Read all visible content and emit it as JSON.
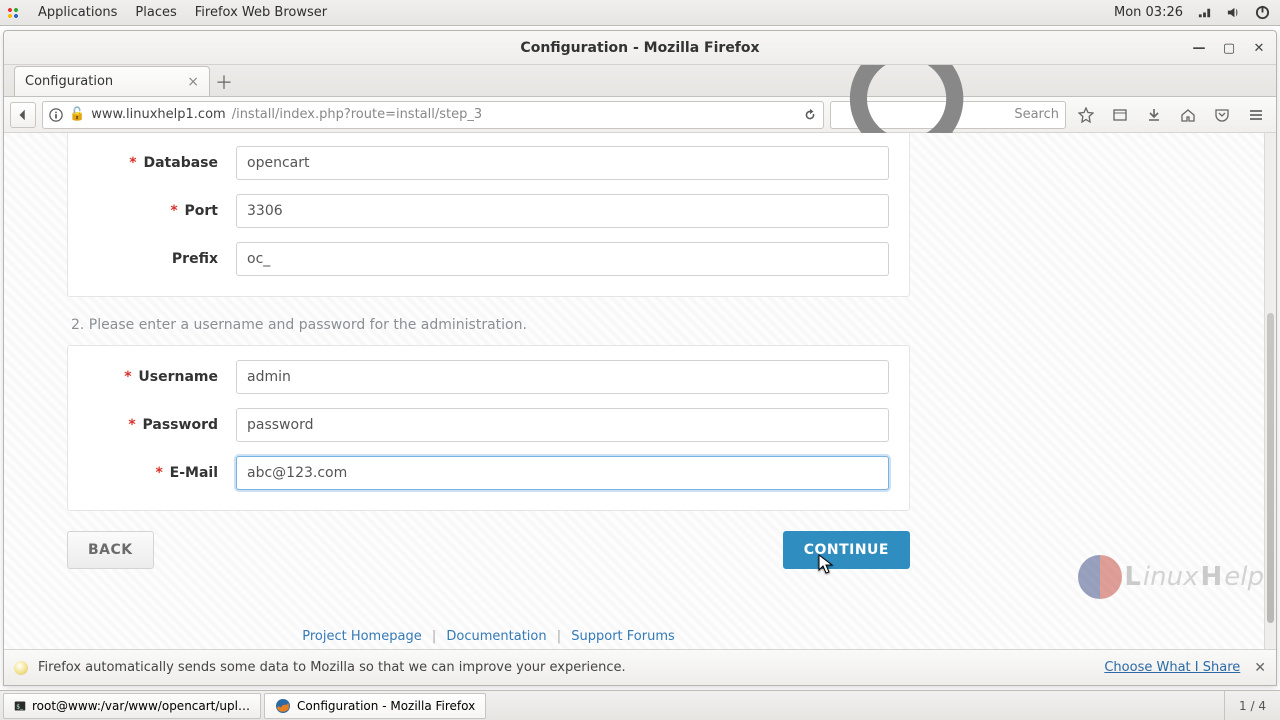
{
  "panel": {
    "applications": "Applications",
    "places": "Places",
    "app_name": "Firefox Web Browser",
    "clock": "Mon 03:26"
  },
  "window": {
    "title": "Configuration - Mozilla Firefox"
  },
  "tab": {
    "title": "Configuration"
  },
  "url": {
    "host": "www.linuxhelp1.com",
    "path": "/install/index.php?route=install/step_3"
  },
  "search": {
    "placeholder": "Search"
  },
  "form": {
    "database": {
      "label": "Database",
      "value": "opencart"
    },
    "port": {
      "label": "Port",
      "value": "3306"
    },
    "prefix": {
      "label": "Prefix",
      "value": "oc_"
    },
    "section2": "2. Please enter a username and password for the administration.",
    "username": {
      "label": "Username",
      "value": "admin"
    },
    "password": {
      "label": "Password",
      "value": "password"
    },
    "email": {
      "label": "E-Mail",
      "value": "abc@123.com"
    },
    "back": "BACK",
    "continue": "CONTINUE"
  },
  "footer": {
    "project": "Project Homepage",
    "docs": "Documentation",
    "forums": "Support Forums"
  },
  "watermark": {
    "a": "L",
    "b": "inux",
    "c": "H",
    "d": "elp"
  },
  "notif": {
    "text": "Firefox automatically sends some data to Mozilla so that we can improve your experience.",
    "choose": "Choose What I Share"
  },
  "tasks": {
    "terminal": "root@www:/var/www/opencart/upl…",
    "firefox": "Configuration - Mozilla Firefox",
    "workspace": "1 / 4"
  }
}
